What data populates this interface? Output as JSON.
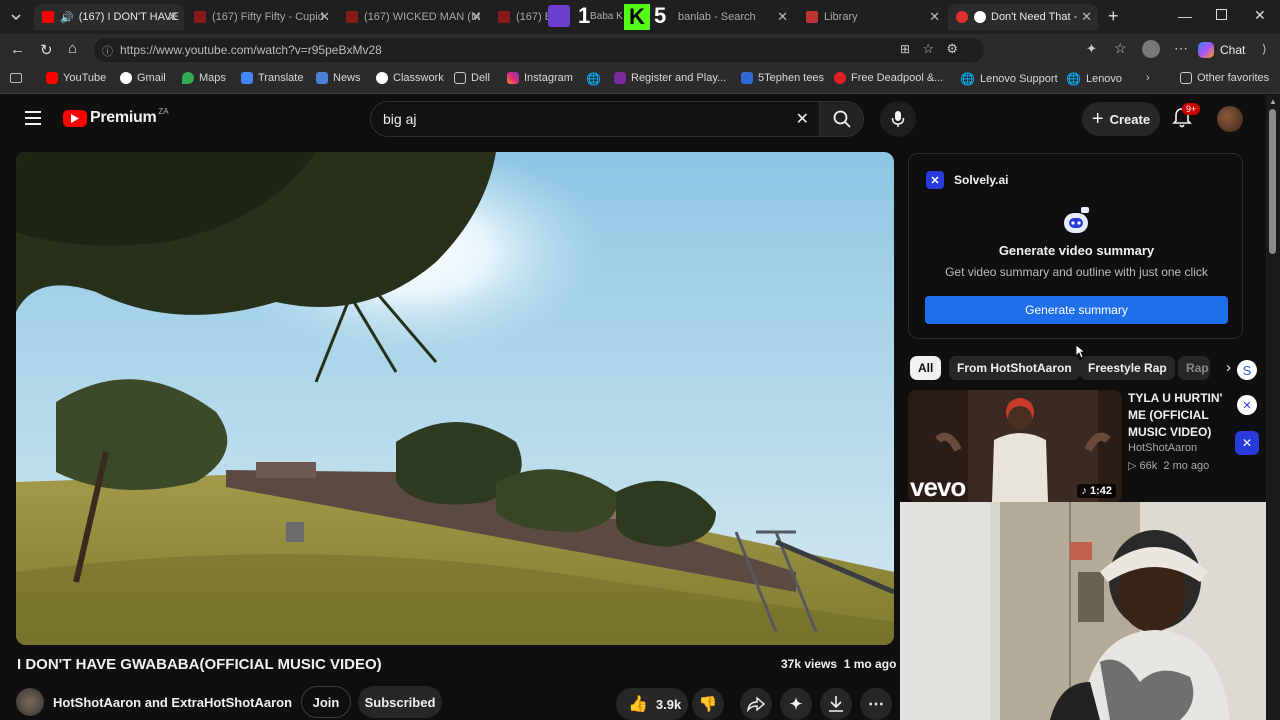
{
  "browser": {
    "tabs": [
      {
        "label": "(167) I DON'T HAVE",
        "active": true
      },
      {
        "label": "(167) Fifty Fifty - Cupid"
      },
      {
        "label": "(167) WICKED MAN (M"
      },
      {
        "label": "(167) Bl..."
      },
      {
        "label": "banlab - Search"
      },
      {
        "label": "Library"
      },
      {
        "label": "Don't Need That -",
        "active": true
      }
    ],
    "tab_overlay_text": "Baba K",
    "url": "https://www.youtube.com/watch?v=r95peBxMv28",
    "chat_label": "Chat",
    "bookmarks": [
      "YouTube",
      "Gmail",
      "Maps",
      "Translate",
      "News",
      "Classwork",
      "Dell",
      "Instagram",
      "Register and Play...",
      "5Tephen tees",
      "Free Deadpool &...",
      "Lenovo Support",
      "Lenovo"
    ],
    "other_favorites": "Other favorites"
  },
  "youtube": {
    "logo_text": "Premium",
    "region": "ZA",
    "search_value": "big aj",
    "create_label": "Create",
    "notif_badge": "9+"
  },
  "video": {
    "title": "I DON'T HAVE GWABABA(OFFICIAL MUSIC VIDEO)",
    "views": "37k views",
    "age": "1 mo ago",
    "channel": "HotShotAaron and ExtraHotShotAaron",
    "join_label": "Join",
    "subscribed_label": "Subscribed",
    "likes": "3.9k"
  },
  "solvely": {
    "brand": "Solvely.ai",
    "heading": "Generate video summary",
    "subtext": "Get video summary and outline with just one click",
    "button": "Generate summary"
  },
  "chips": [
    "All",
    "From HotShotAaron",
    "Freestyle Rap",
    "Rap"
  ],
  "recommended": {
    "title": "TYLA U HURTIN' ME (OFFICIAL MUSIC VIDEO)",
    "channel": "HotShotAaron",
    "views": "66k",
    "age": "2 mo ago",
    "duration": "1:42",
    "thumb_brand": "vevo"
  },
  "tab_overlay_digits": [
    "1",
    "5"
  ],
  "overlay_k": "K",
  "side_ext_s": "S"
}
